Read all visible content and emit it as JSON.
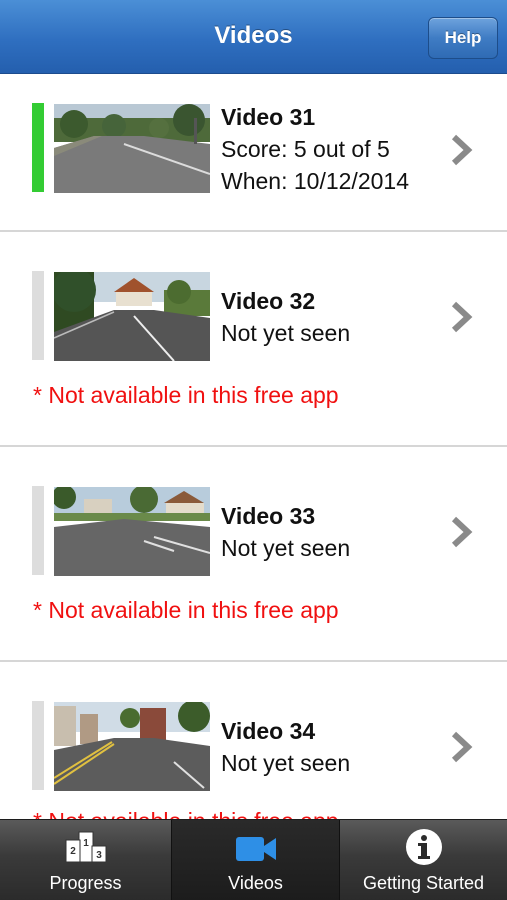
{
  "header": {
    "title": "Videos",
    "help_label": "Help"
  },
  "videos": [
    {
      "title": "Video 31",
      "score_label": "Score:",
      "score_value": "5 out of 5",
      "when_label": "When:",
      "when_value": "10/12/2014",
      "status_color": "#33cc33",
      "thumbnail": "road-thumbnail"
    },
    {
      "title": "Video 32",
      "status_text": "Not yet seen",
      "status_color": "#dddddd",
      "notice": "* Not available in this free app",
      "thumbnail": "road-thumbnail"
    },
    {
      "title": "Video 33",
      "status_text": "Not yet seen",
      "status_color": "#dddddd",
      "notice": "* Not available in this free app",
      "thumbnail": "road-thumbnail"
    },
    {
      "title": "Video 34",
      "status_text": "Not yet seen",
      "status_color": "#dddddd",
      "notice": "* Not available in this free app",
      "thumbnail": "road-thumbnail"
    }
  ],
  "tabs": [
    {
      "label": "Progress",
      "icon": "podium-icon",
      "active": false
    },
    {
      "label": "Videos",
      "icon": "video-camera-icon",
      "active": true
    },
    {
      "label": "Getting Started",
      "icon": "info-icon",
      "active": false
    }
  ],
  "colors": {
    "header_blue": "#2f6fc0",
    "notice_red": "#f01010",
    "active_tab_icon": "#2e8fe6"
  }
}
